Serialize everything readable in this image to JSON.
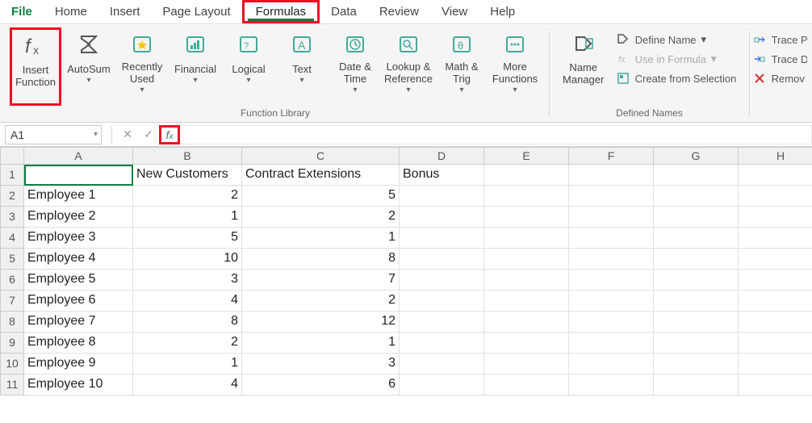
{
  "menu": {
    "file": "File",
    "home": "Home",
    "insert": "Insert",
    "page_layout": "Page Layout",
    "formulas": "Formulas",
    "data": "Data",
    "review": "Review",
    "view": "View",
    "help": "Help"
  },
  "ribbon": {
    "function_library": {
      "label": "Function Library",
      "insert_function": "Insert\nFunction",
      "autosum": "AutoSum",
      "recently_used": "Recently\nUsed",
      "financial": "Financial",
      "logical": "Logical",
      "text": "Text",
      "date_time": "Date &\nTime",
      "lookup_ref": "Lookup &\nReference",
      "math_trig": "Math &\nTrig",
      "more_functions": "More\nFunctions"
    },
    "defined_names": {
      "label": "Defined Names",
      "name_manager": "Name\nManager",
      "define_name": "Define Name",
      "use_in_formula": "Use in Formula",
      "create_from_selection": "Create from Selection"
    },
    "auditing": {
      "trace_precedents": "Trace P",
      "trace_dependents": "Trace D",
      "remove_arrows": "Remov"
    }
  },
  "formula_bar": {
    "name_box": "A1",
    "formula": ""
  },
  "sheet": {
    "columns": [
      "A",
      "B",
      "C",
      "D",
      "E",
      "F",
      "G",
      "H"
    ],
    "headers": {
      "B": "New Customers",
      "C": "Contract Extensions",
      "D": "Bonus"
    },
    "rows": [
      {
        "n": 1,
        "A": "",
        "B": "New Customers",
        "C": "Contract Extensions",
        "D": "Bonus"
      },
      {
        "n": 2,
        "A": "Employee 1",
        "B": "2",
        "C": "5"
      },
      {
        "n": 3,
        "A": "Employee 2",
        "B": "1",
        "C": "2"
      },
      {
        "n": 4,
        "A": "Employee 3",
        "B": "5",
        "C": "1"
      },
      {
        "n": 5,
        "A": "Employee 4",
        "B": "10",
        "C": "8"
      },
      {
        "n": 6,
        "A": "Employee 5",
        "B": "3",
        "C": "7"
      },
      {
        "n": 7,
        "A": "Employee 6",
        "B": "4",
        "C": "2"
      },
      {
        "n": 8,
        "A": "Employee 7",
        "B": "8",
        "C": "12"
      },
      {
        "n": 9,
        "A": "Employee 8",
        "B": "2",
        "C": "1"
      },
      {
        "n": 10,
        "A": "Employee 9",
        "B": "1",
        "C": "3"
      },
      {
        "n": 11,
        "A": "Employee 10",
        "B": "4",
        "C": "6"
      }
    ]
  }
}
